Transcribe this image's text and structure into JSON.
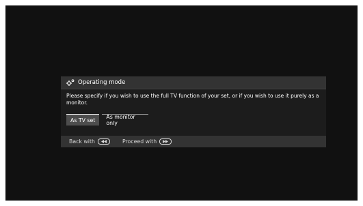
{
  "dialog": {
    "title": "Operating mode",
    "title_icon": "settings-gear-icon",
    "description": "Please specify if you wish to use the full TV function of your set, or if you wish to use it purely as a monitor.",
    "options": [
      {
        "label": "As TV set",
        "selected": true
      },
      {
        "label": "As monitor only",
        "selected": false
      }
    ],
    "footer": {
      "back_label": "Back with",
      "back_icon": "rewind-button-icon",
      "proceed_label": "Proceed with",
      "proceed_icon": "fast-forward-button-icon"
    }
  },
  "colors": {
    "screen_bg": "#111111",
    "dialog_bg": "#333333",
    "content_bg": "#1c1c1c",
    "selected_bg": "#4d4d4d"
  }
}
